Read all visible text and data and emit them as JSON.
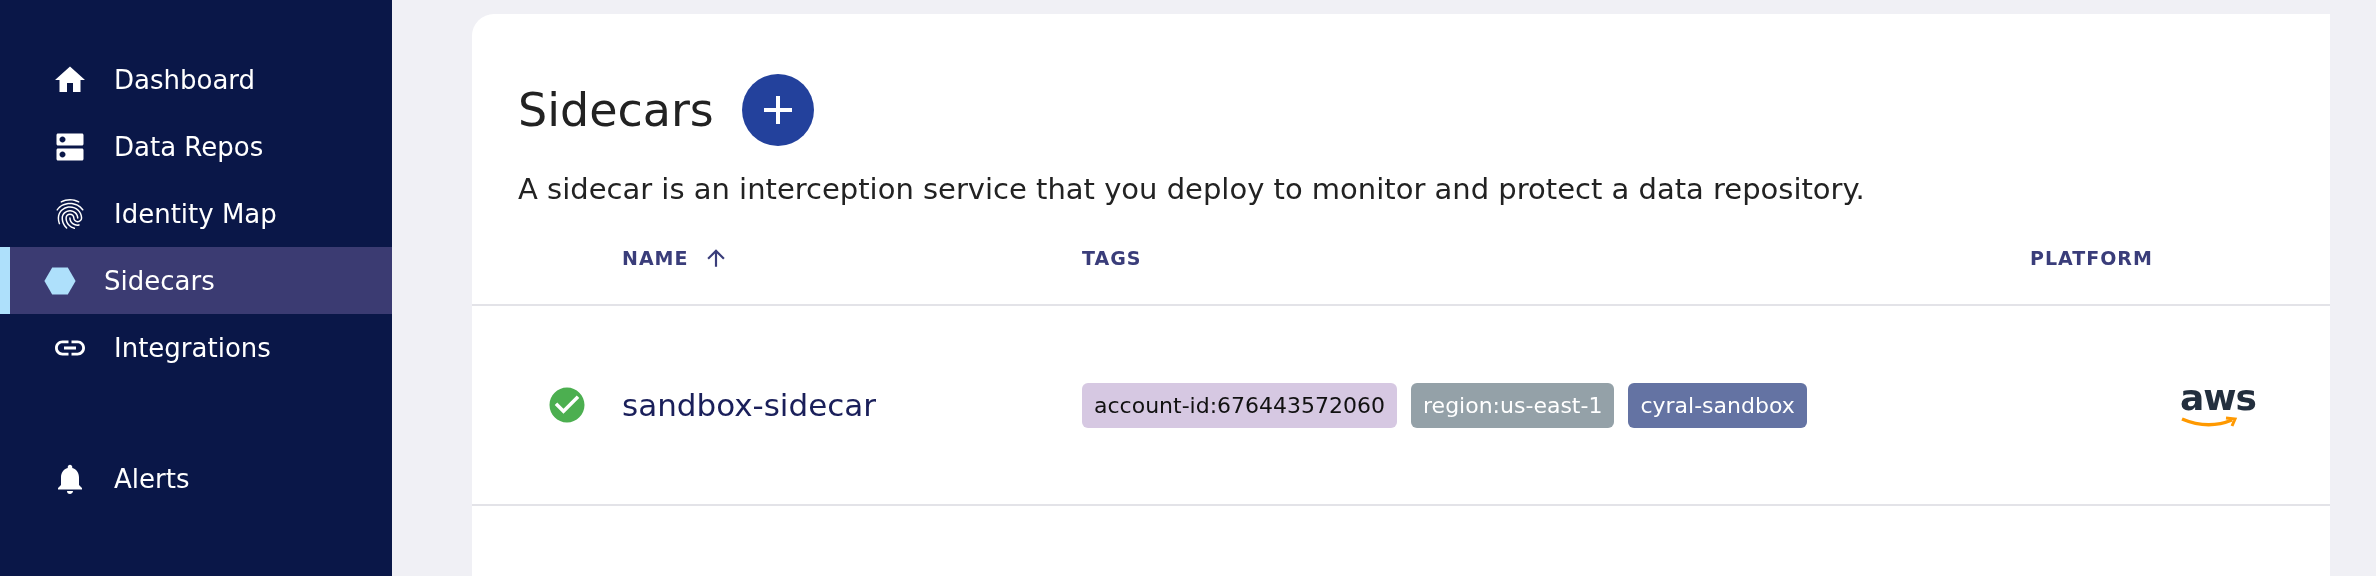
{
  "sidebar": {
    "items": [
      {
        "label": "Dashboard",
        "selected": false
      },
      {
        "label": "Data Repos",
        "selected": false
      },
      {
        "label": "Identity Map",
        "selected": false
      },
      {
        "label": "Sidecars",
        "selected": true
      },
      {
        "label": "Integrations",
        "selected": false
      }
    ],
    "bottom_items": [
      {
        "label": "Alerts",
        "selected": false
      }
    ]
  },
  "page": {
    "title": "Sidecars",
    "description": "A sidecar is an interception service that you deploy to monitor and protect a data repository."
  },
  "table": {
    "columns": [
      {
        "label": "NAME",
        "sorted": true
      },
      {
        "label": "TAGS",
        "sorted": false
      },
      {
        "label": "PLATFORM",
        "sorted": false
      }
    ],
    "rows": [
      {
        "healthy": true,
        "name": "sandbox-sidecar",
        "tags": [
          {
            "label": "account-id:676443572060",
            "color": "#d6c8e2"
          },
          {
            "label": "region:us-east-1",
            "color": "#94a1a8"
          },
          {
            "label": "cyral-sandbox",
            "color": "#6473a3"
          }
        ],
        "platform": "aws"
      }
    ]
  }
}
